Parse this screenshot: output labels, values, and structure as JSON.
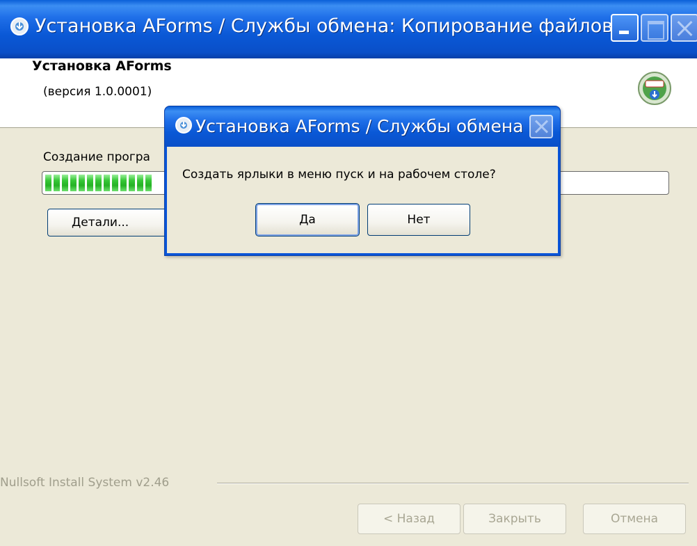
{
  "window": {
    "title": "Установка AForms / Службы обмена: Копирование файлов",
    "icon": "installer-disc-icon",
    "controls": [
      "minimize",
      "maximize",
      "close"
    ]
  },
  "header": {
    "title": "Установка AForms",
    "subtitle": "(версия 1.0.0001)",
    "logo_icon": "nsis-installer-icon"
  },
  "status": {
    "text": "Создание програ",
    "progress_percent": 18
  },
  "buttons": {
    "details": "Детали...",
    "back": "< Назад",
    "close": "Закрыть",
    "cancel": "Отмена"
  },
  "footer": {
    "credit": "Nullsoft Install System v2.46"
  },
  "dialog": {
    "title": "Установка AForms / Службы обмена",
    "message": "Создать ярлыки в меню пуск и на рабочем столе?",
    "yes_label": "Да",
    "no_label": "Нет"
  },
  "colors": {
    "titlebar_blue": "#0a58d6",
    "dialog_face": "#ece9d8",
    "progress_green": "#24b224"
  }
}
